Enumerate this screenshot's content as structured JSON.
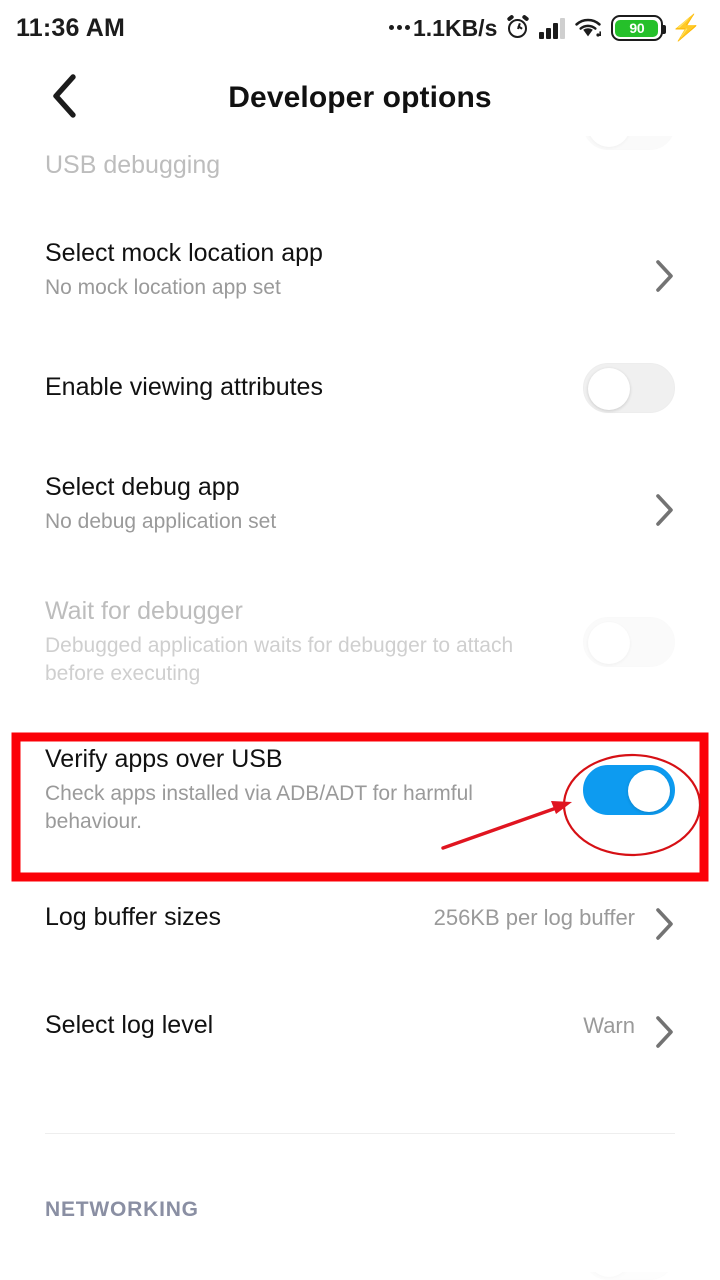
{
  "status_bar": {
    "clock": "11:36 AM",
    "network_speed": "1.1KB/s",
    "alarm_icon": "alarm-clock-icon",
    "signal_icon": "cellular-signal-icon",
    "wifi_icon": "wifi-icon",
    "battery_level": "90",
    "charging_icon": "lightning-bolt-icon",
    "battery_color": "#25c02a"
  },
  "header": {
    "back_icon": "chevron-left-icon",
    "title": "Developer options"
  },
  "settings": {
    "rows": [
      {
        "title": "USB debugging",
        "sub": "",
        "control": "toggle-partial",
        "state": "off",
        "dim": true
      },
      {
        "title": "Select mock location app",
        "sub": "No mock location app set",
        "control": "chevron",
        "state": "",
        "dim": false
      },
      {
        "title": "Enable viewing attributes",
        "sub": "",
        "control": "toggle",
        "state": "off",
        "dim": false
      },
      {
        "title": "Select debug app",
        "sub": "No debug application set",
        "control": "chevron",
        "state": "",
        "dim": false
      },
      {
        "title": "Wait for debugger",
        "sub": "Debugged application waits for debugger to attach before executing",
        "control": "toggle",
        "state": "off",
        "dim": true
      },
      {
        "title": "Verify apps over USB",
        "sub": "Check apps installed via ADB/ADT for harmful behaviour.",
        "control": "toggle",
        "state": "on",
        "dim": false,
        "highlighted": true
      },
      {
        "title": "Log buffer sizes",
        "sub": "",
        "value": "256KB per log buffer",
        "control": "chevron",
        "state": "",
        "dim": false
      },
      {
        "title": "Select log level",
        "sub": "",
        "value": "Warn",
        "control": "chevron",
        "state": "",
        "dim": false
      }
    ],
    "section_header": "NETWORKING"
  },
  "annotation": {
    "box_color": "#fb0007",
    "ellipse_color": "#d61015",
    "arrow_color": "#e01520",
    "target": "Verify apps over USB",
    "toggle_on_color": "#0d9bf0"
  }
}
